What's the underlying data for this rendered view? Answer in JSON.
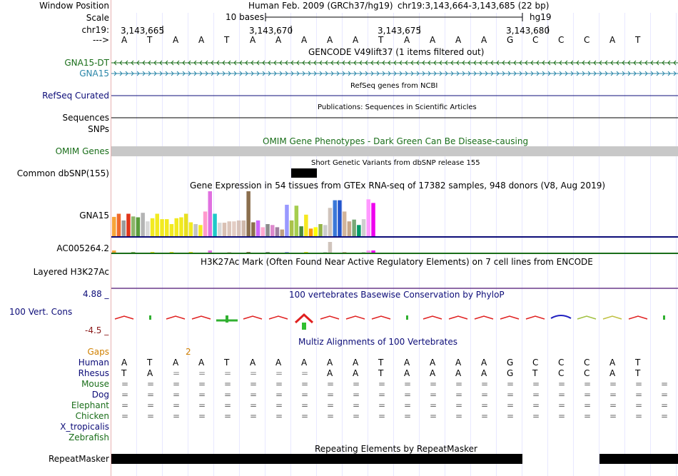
{
  "header": {
    "window_position_label": "Window Position",
    "scale_label": "Scale",
    "chr_label": "chr19:",
    "arrow_label": "--->",
    "assembly": "Human Feb. 2009 (GRCh37/hg19)",
    "position": "chr19:3,143,664-3,143,685 (22 bp)",
    "scale_text": "10 bases",
    "db": "hg19",
    "ticks": [
      "3,143,665",
      "3,143,670",
      "3,143,675",
      "3,143,680"
    ]
  },
  "bases": [
    "A",
    "T",
    "A",
    "A",
    "T",
    "A",
    "A",
    "A",
    "A",
    "A",
    "T",
    "A",
    "A",
    "A",
    "A",
    "G",
    "C",
    "C",
    "C",
    "A",
    "T"
  ],
  "tracks": {
    "gencode": {
      "title": "GENCODE V49lift37 (1 items filtered out)",
      "genes": [
        "GNA15-DT",
        "GNA15"
      ],
      "colors": [
        "#1a6e1a",
        "#2a86a8"
      ]
    },
    "refseq": {
      "label": "RefSeq Curated",
      "title": "RefSeq genes from NCBI",
      "color": "#0c0c78"
    },
    "publications": {
      "label": "Sequences",
      "title": "Publications: Sequences in Scientific Articles"
    },
    "snps_label": "SNPs",
    "omim": {
      "label": "OMIM Genes",
      "title": "OMIM Gene Phenotypes - Dark Green Can Be Disease-causing",
      "color": "#1a6e1a"
    },
    "dbsnp": {
      "label": "Common dbSNP(155)",
      "title": "Short Genetic Variants from dbSNP release 155"
    },
    "gtex": {
      "title": "Gene Expression in 54 tissues from GTEx RNA-seq of 17382 samples, 948 donors (V8, Aug 2019)",
      "genes": [
        "GNA15",
        "AC005264.2"
      ],
      "bar_heights": [
        0.43,
        0.5,
        0.35,
        0.5,
        0.44,
        0.42,
        0.52,
        0.33,
        0.4,
        0.5,
        0.38,
        0.38,
        0.27,
        0.4,
        0.42,
        0.5,
        0.31,
        0.27,
        0.25,
        0.55,
        1.0,
        0.5,
        0.3,
        0.3,
        0.33,
        0.33,
        0.35,
        0.35,
        1.0,
        0.31,
        0.35,
        0.2,
        0.27,
        0.25,
        0.2,
        0.15,
        0.7,
        0.35,
        0.68,
        0.22,
        0.48,
        0.17,
        0.2,
        0.27,
        0.25,
        0.63,
        0.8,
        0.8,
        0.55,
        0.33,
        0.37,
        0.25,
        0.38,
        0.82,
        0.74
      ],
      "colors": [
        "#f7a53a",
        "#f06b2c",
        "#9a9a9a",
        "#e0351b",
        "#8db56a",
        "#5a9c3c",
        "#b4b4b4",
        "#d9d9d9",
        "#f2ea20",
        "#f2ea20",
        "#f2ea20",
        "#f2ea20",
        "#f2ea20",
        "#f2ea20",
        "#f2ea20",
        "#e8e020",
        "#f2ea20",
        "#c2c2c2",
        "#f2ea20",
        "#ff99cc",
        "#e070e0",
        "#1fc9c9",
        "#d8d8d8",
        "#d9c0b3",
        "#dcc6bc",
        "#e3cdc4",
        "#d7c2ba",
        "#cfb8aa",
        "#8b6f4e",
        "#8b6f4e",
        "#cc66ff",
        "#ffa8d0",
        "#8c8c8c",
        "#dd88cc",
        "#a080a0",
        "#c0a080",
        "#9999ff",
        "#aac24a",
        "#a5cd4f",
        "#4c8a3d",
        "#f5e821",
        "#ff9900",
        "#ffff00",
        "#94b447",
        "#cccccc",
        "#d0c4bc",
        "#3a78d8",
        "#2255cc",
        "#d2b59b",
        "#c8a88a",
        "#79a877",
        "#009966",
        "#cfcfcf",
        "#ff99ff",
        "#ee00ee"
      ]
    },
    "h3k27ac": {
      "label": "Layered H3K27Ac",
      "title": "H3K27Ac Mark (Often Found Near Active Regulatory Elements) on 7 cell lines from ENCODE"
    },
    "cons": {
      "label": "100 Vert. Cons",
      "max": "4.88 _",
      "min": "-4.5 _",
      "title": "100 vertebrates Basewise Conservation by PhyloP"
    },
    "multiz": {
      "title": "Multiz Alignments of 100 Vertebrates",
      "gaps_label": "Gaps",
      "gap_value": "2",
      "species": [
        "Human",
        "Rhesus",
        "Mouse",
        "Dog",
        "Elephant",
        "Chicken",
        "X_tropicalis",
        "Zebrafish"
      ],
      "rhesus": [
        "A",
        "T",
        "A",
        "=",
        "=",
        "=",
        "=",
        "=",
        "=",
        "A",
        "A",
        "T",
        "A",
        "A",
        "A",
        "A",
        "G",
        "T",
        "C",
        "C",
        "A",
        "T"
      ],
      "eq_rows": 4
    },
    "repeatmasker": {
      "label": "RepeatMasker",
      "title": "Repeating Elements by RepeatMasker"
    }
  },
  "colors": {
    "navy": "#0c0c78",
    "green": "#1a6e1a",
    "teal": "#2a86a8",
    "orange": "#d08000",
    "darkred": "#8b1a1a",
    "red": "#e02020"
  }
}
